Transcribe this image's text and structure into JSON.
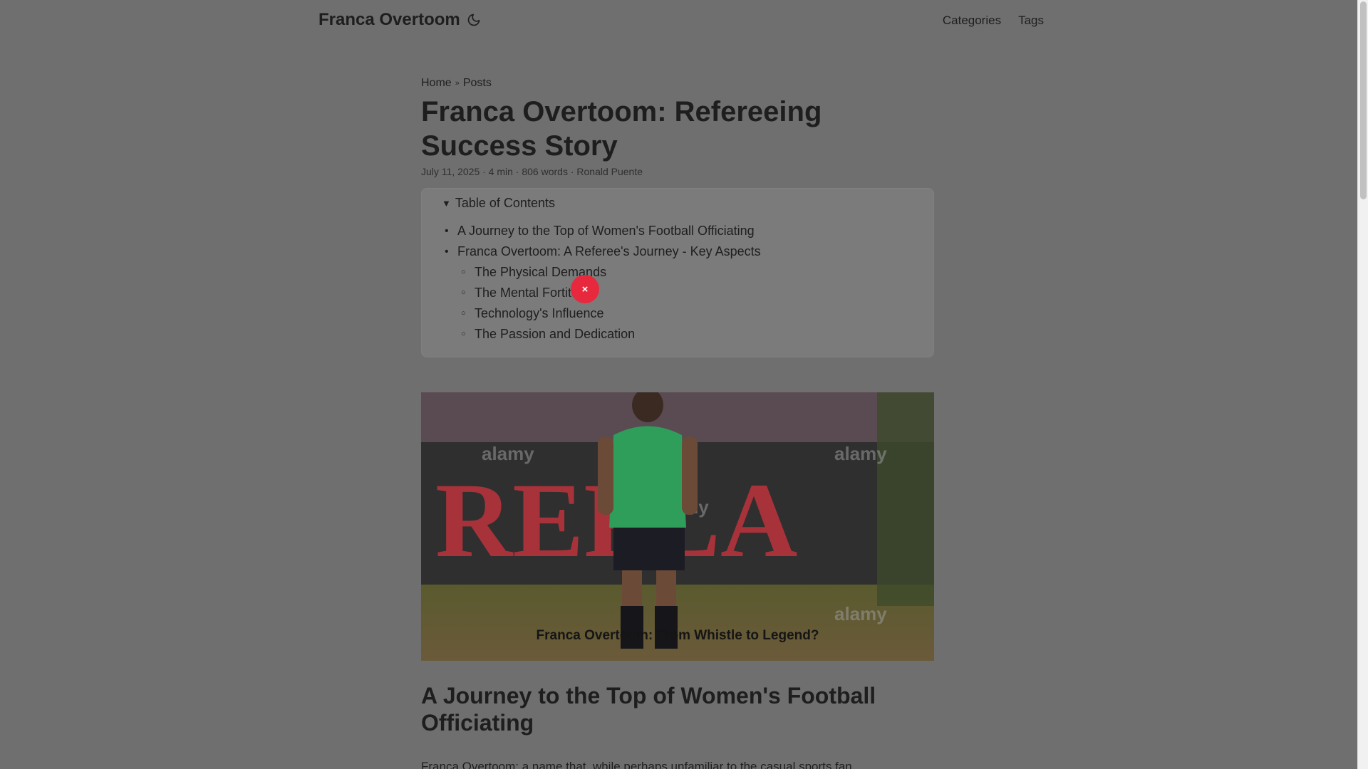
{
  "site": {
    "title": "Franca Overtoom",
    "theme_toggle_icon": "moon-icon"
  },
  "nav": {
    "items": [
      {
        "label": "Categories"
      },
      {
        "label": "Tags"
      }
    ]
  },
  "breadcrumb": {
    "home": "Home",
    "separator": "»",
    "posts": "Posts"
  },
  "post": {
    "title": "Franca Overtoom: Refereeing Success Story",
    "meta": "July 11, 2025 · 4 min · 806 words · Ronald Puente"
  },
  "toc": {
    "summary": "Table of Contents",
    "items": [
      {
        "label": "A Journey to the Top of Women's Football Officiating"
      },
      {
        "label": "Franca Overtoom: A Referee's Journey - Key Aspects"
      }
    ],
    "subitems": [
      {
        "label": "The Physical Demands"
      },
      {
        "label": "The Mental Fortitude"
      },
      {
        "label": "Technology's Influence"
      },
      {
        "label": "The Passion and Dedication"
      }
    ]
  },
  "overlay": {
    "close_label": "×",
    "color": "#e8283d"
  },
  "cover": {
    "caption": "Franca Overtoom: From Whistle to Legend?",
    "banner_text": "REPLA",
    "watermark": "alamy"
  },
  "section": {
    "heading": "A Journey to the Top of Women's Football Officiating",
    "paragraph_start": "Franca Overtoom: a name that, while perhaps unfamiliar to the casual sports fan,"
  },
  "colors": {
    "background": "#6f6f6f",
    "text": "#1e1e1e",
    "toc_bg": "#7b7b7b"
  }
}
